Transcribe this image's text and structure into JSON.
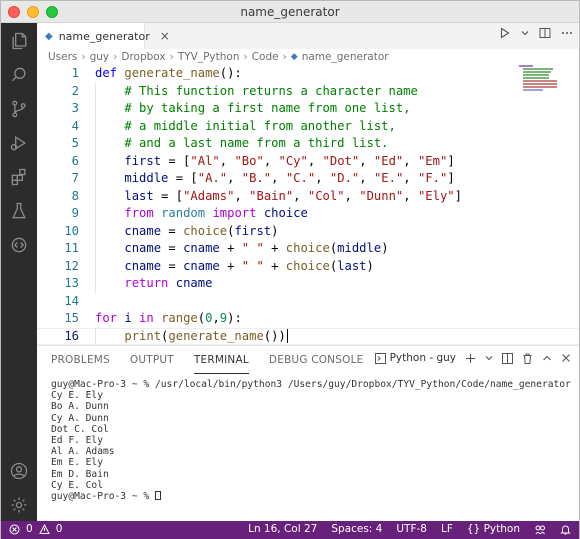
{
  "window": {
    "title": "name_generator"
  },
  "tab": {
    "label": "name_generator",
    "close": "×"
  },
  "breadcrumb": [
    "Users",
    "guy",
    "Dropbox",
    "TYV_Python",
    "Code",
    "name_generator"
  ],
  "editor": {
    "lines": [
      "def generate_name():",
      "    # This function returns a character name",
      "    # by taking a first name from one list,",
      "    # a middle initial from another list,",
      "    # and a last name from a third list.",
      "    first = [\"Al\", \"Bo\", \"Cy\", \"Dot\", \"Ed\", \"Em\"]",
      "    middle = [\"A.\", \"B.\", \"C.\", \"D.\", \"E.\", \"F.\"]",
      "    last = [\"Adams\", \"Bain\", \"Col\", \"Dunn\", \"Ely\"]",
      "    from random import choice",
      "    cname = choice(first)",
      "    cname = cname + \" \" + choice(middle)",
      "    cname = cname + \" \" + choice(last)",
      "    return cname",
      "",
      "for i in range(0,9):",
      "    print(generate_name())"
    ],
    "line_numbers": [
      "1",
      "2",
      "3",
      "4",
      "5",
      "6",
      "7",
      "8",
      "9",
      "10",
      "11",
      "12",
      "13",
      "14",
      "15",
      "16"
    ],
    "active_line": 16
  },
  "panel": {
    "tabs": [
      "PROBLEMS",
      "OUTPUT",
      "TERMINAL",
      "DEBUG CONSOLE"
    ],
    "active_tab": "TERMINAL",
    "terminal_select": "Python - guy",
    "terminal": [
      "guy@Mac-Pro-3 ~ % /usr/local/bin/python3 /Users/guy/Dropbox/TYV_Python/Code/name_generator",
      "Cy E. Ely",
      "Bo A. Dunn",
      "Cy A. Dunn",
      "Dot C. Col",
      "Ed F. Ely",
      "Al A. Adams",
      "Em E. Ely",
      "Em D. Bain",
      "Cy E. Col",
      "guy@Mac-Pro-3 ~ % "
    ]
  },
  "status": {
    "errors": "0",
    "warnings": "0",
    "position": "Ln 16, Col 27",
    "spaces": "Spaces: 4",
    "encoding": "UTF-8",
    "eol": "LF",
    "braces": "{}",
    "language": "Python"
  },
  "colors": {
    "statusbar": "#68217a",
    "activitybar": "#2c2c2c",
    "keyword": "#af00db",
    "comment": "#008000",
    "string": "#a31515",
    "number": "#098658",
    "function": "#795e26",
    "line_number": "#237893"
  }
}
